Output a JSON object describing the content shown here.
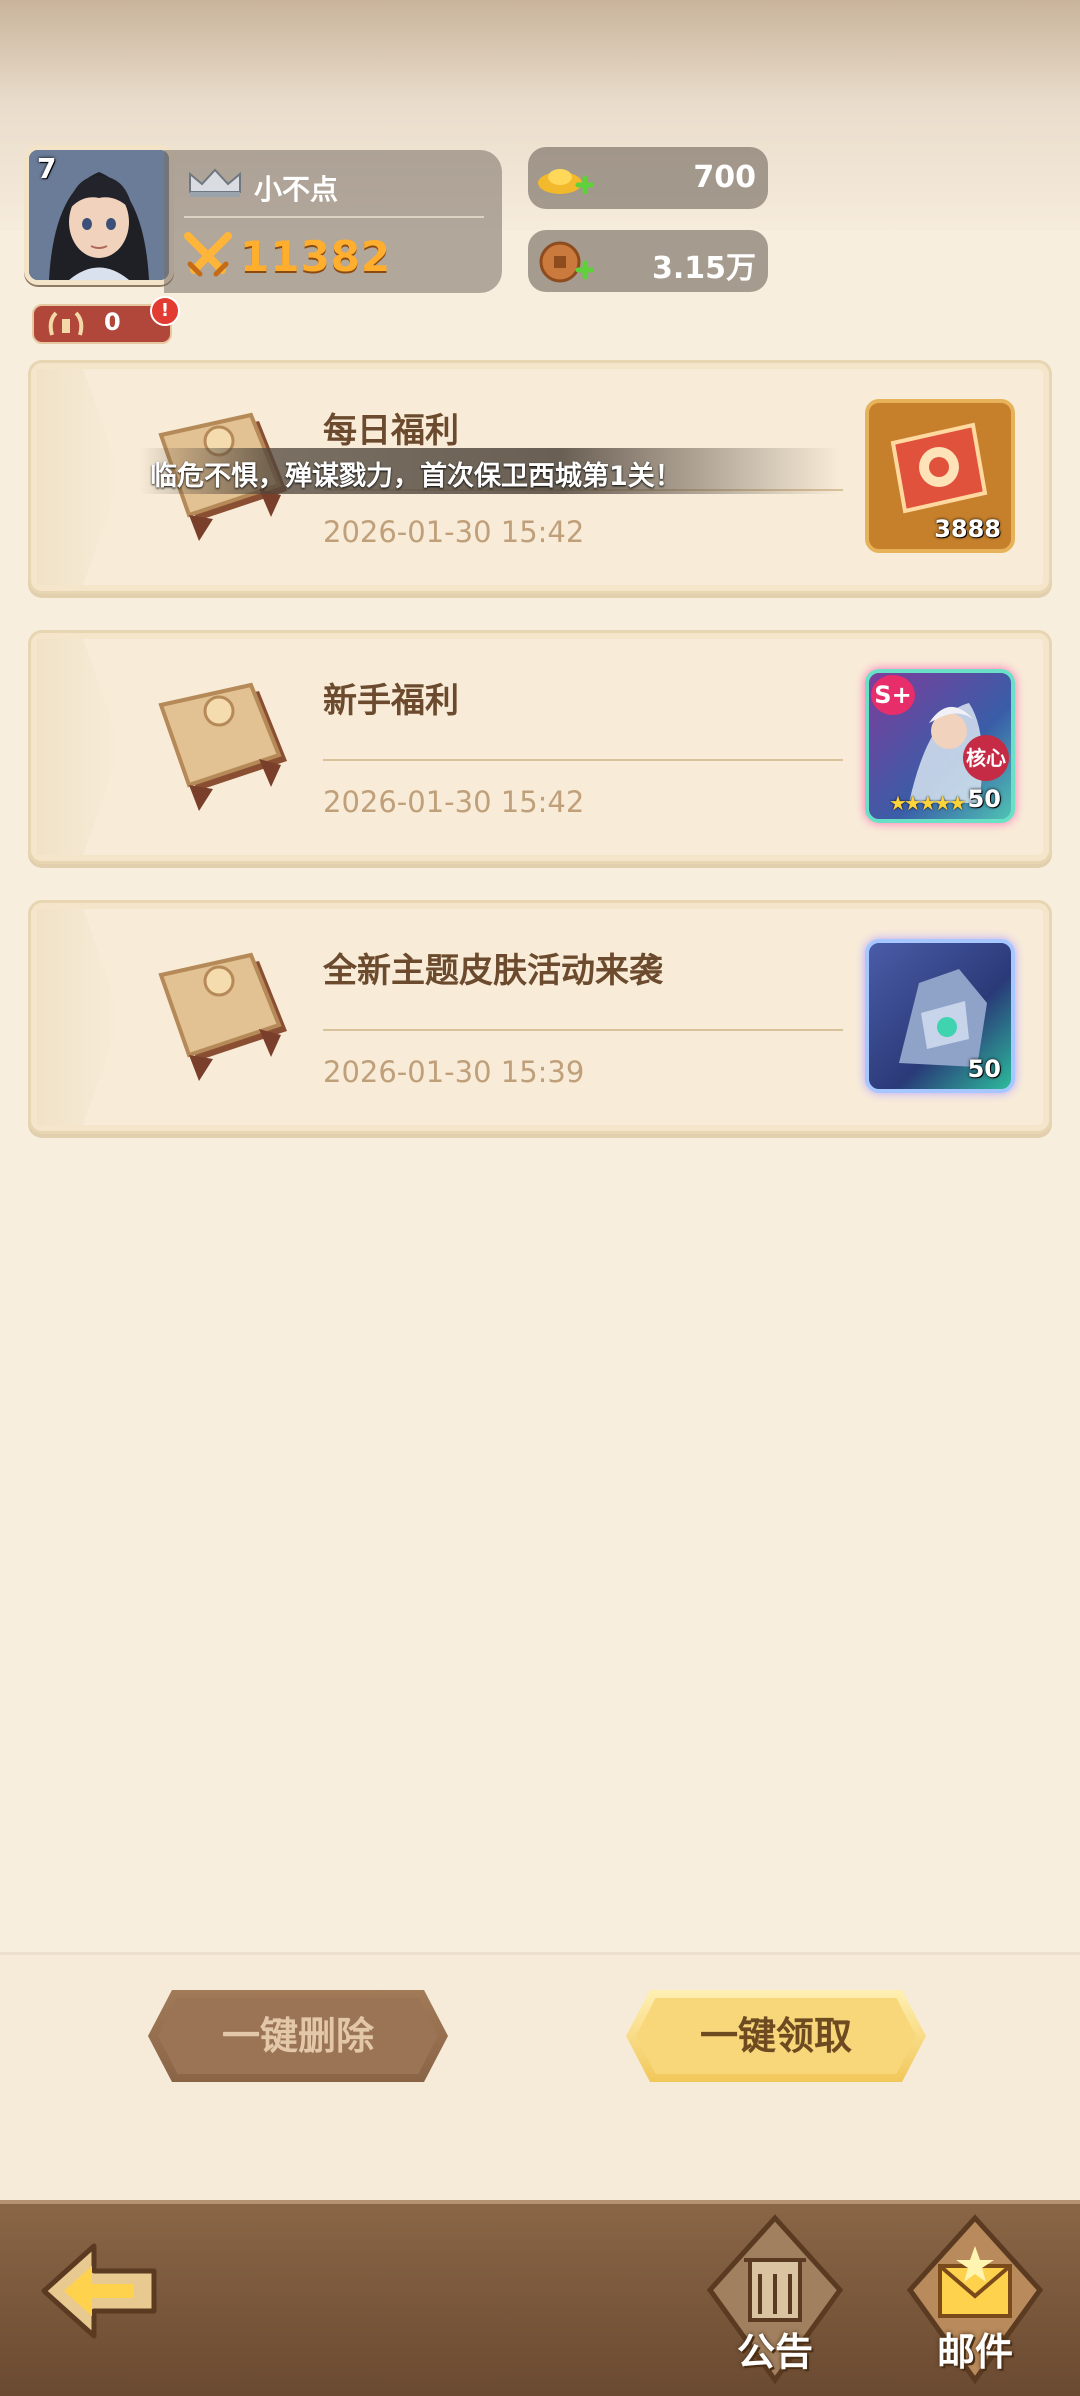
{
  "player": {
    "level": "7",
    "name": "小不点",
    "power": "11382",
    "honor": "0",
    "alert": "!"
  },
  "resources": {
    "gold": "700",
    "coins": "3.15万"
  },
  "notice_marquee": "临危不惧，殚谋戮力，首次保卫西城第1关！",
  "mails": [
    {
      "title": "每日福利",
      "time": "2026-01-30 15:42",
      "reward_count": "3888",
      "reward_icon": "ticket-icon"
    },
    {
      "title": "新手福利",
      "time": "2026-01-30 15:42",
      "reward_count": "50",
      "reward_badge": "S+",
      "reward_tag": "核心",
      "reward_icon": "hero-card-icon"
    },
    {
      "title": "全新主题皮肤活动来袭",
      "time": "2026-01-30 15:39",
      "reward_count": "50",
      "reward_icon": "skin-card-icon"
    }
  ],
  "actions": {
    "delete_all": "一键删除",
    "claim_all": "一键领取"
  },
  "nav": {
    "notice": "公告",
    "mail": "邮件"
  },
  "colors": {
    "background": "#f8eedd",
    "title_text": "#6b4a2e",
    "time_text": "#c0a07a",
    "power": "#ffae2d",
    "nav_bar": "#7a573a"
  }
}
